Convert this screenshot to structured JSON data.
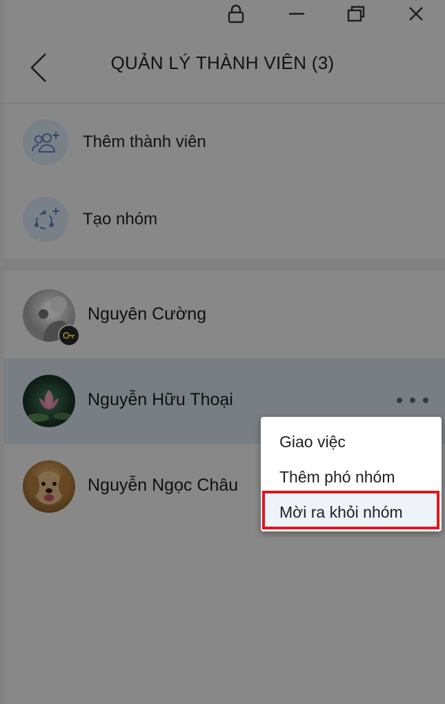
{
  "header": {
    "title": "QUẢN LÝ THÀNH VIÊN (3)"
  },
  "actions": [
    {
      "label": "Thêm thành viên",
      "icon": "add-people-icon"
    },
    {
      "label": "Tạo nhóm",
      "icon": "create-group-icon"
    }
  ],
  "members": [
    {
      "name": "Nguyên Cường",
      "role_icon": "key-icon"
    },
    {
      "name": "Nguyễn Hữu Thoại"
    },
    {
      "name": "Nguyễn Ngọc Châu"
    }
  ],
  "context_menu": {
    "items": [
      {
        "label": "Giao việc"
      },
      {
        "label": "Thêm phó nhóm"
      },
      {
        "label": "Mời ra khỏi nhóm"
      }
    ]
  },
  "colors": {
    "accent": "#dde9f7",
    "selected_row": "#dbe5ef",
    "highlight": "#e3141c"
  }
}
